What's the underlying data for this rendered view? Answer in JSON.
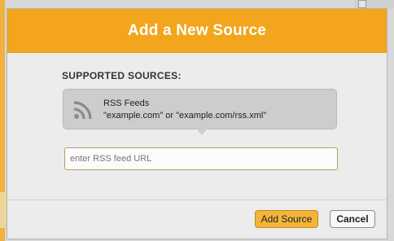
{
  "dialog": {
    "title": "Add a New Source",
    "section_title": "SUPPORTED SOURCES:",
    "source": {
      "name": "RSS Feeds",
      "examples": "\"example.com\" or \"example.com/rss.xml\"",
      "icon": "rss-icon"
    },
    "url_input": {
      "placeholder": "enter RSS feed URL",
      "value": ""
    },
    "buttons": {
      "add_label": "Add Source",
      "cancel_label": "Cancel"
    }
  },
  "colors": {
    "header": "#f3a51d",
    "add_button": "#f2b53a",
    "card": "#cdcdcd"
  }
}
